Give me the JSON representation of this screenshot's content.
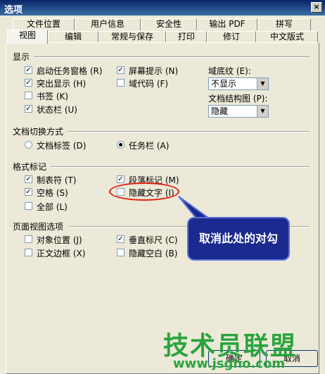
{
  "window": {
    "title": "选项",
    "close": "×"
  },
  "tabs_row1": [
    "文件位置",
    "用户信息",
    "安全性",
    "输出 PDF",
    "拼写"
  ],
  "tabs_row2": [
    "视图",
    "编辑",
    "常规与保存",
    "打印",
    "修订",
    "中文版式"
  ],
  "display": {
    "title": "显示",
    "startup_pane": "启动任务窗格 (R)",
    "highlight": "突出显示 (H)",
    "bookmarks": "书签 (K)",
    "status_bar": "状态栏 (U)",
    "screen_tips": "屏幕提示 (N)",
    "field_codes": "域代码 (F)",
    "field_shading_label": "域底纹 (E):",
    "field_shading_value": "不显示",
    "doc_map_label": "文档结构图 (P):",
    "doc_map_value": "隐藏"
  },
  "doc_switch": {
    "title": "文档切换方式",
    "doc_tabs": "文档标签 (D)",
    "taskbar": "任务栏 (A)"
  },
  "format_marks": {
    "title": "格式标记",
    "tab_chars": "制表符 (T)",
    "spaces": "空格 (S)",
    "all": "全部 (L)",
    "paragraph_marks": "段落标记 (M)",
    "hidden_text": "隐藏文字 (I)"
  },
  "page_view": {
    "title": "页面视图选项",
    "object_anchors": "对象位置 (J)",
    "text_boundaries": "正文边框 (X)",
    "vertical_ruler": "垂直标尺 (C)",
    "hide_whitespace": "隐藏空白 (B)"
  },
  "annotation": {
    "callout": "取消此处的对勾"
  },
  "watermark": {
    "brand": "技术员联盟",
    "url": "www.jsgho.com"
  },
  "buttons": {
    "ok": "确定",
    "cancel": "取消"
  }
}
